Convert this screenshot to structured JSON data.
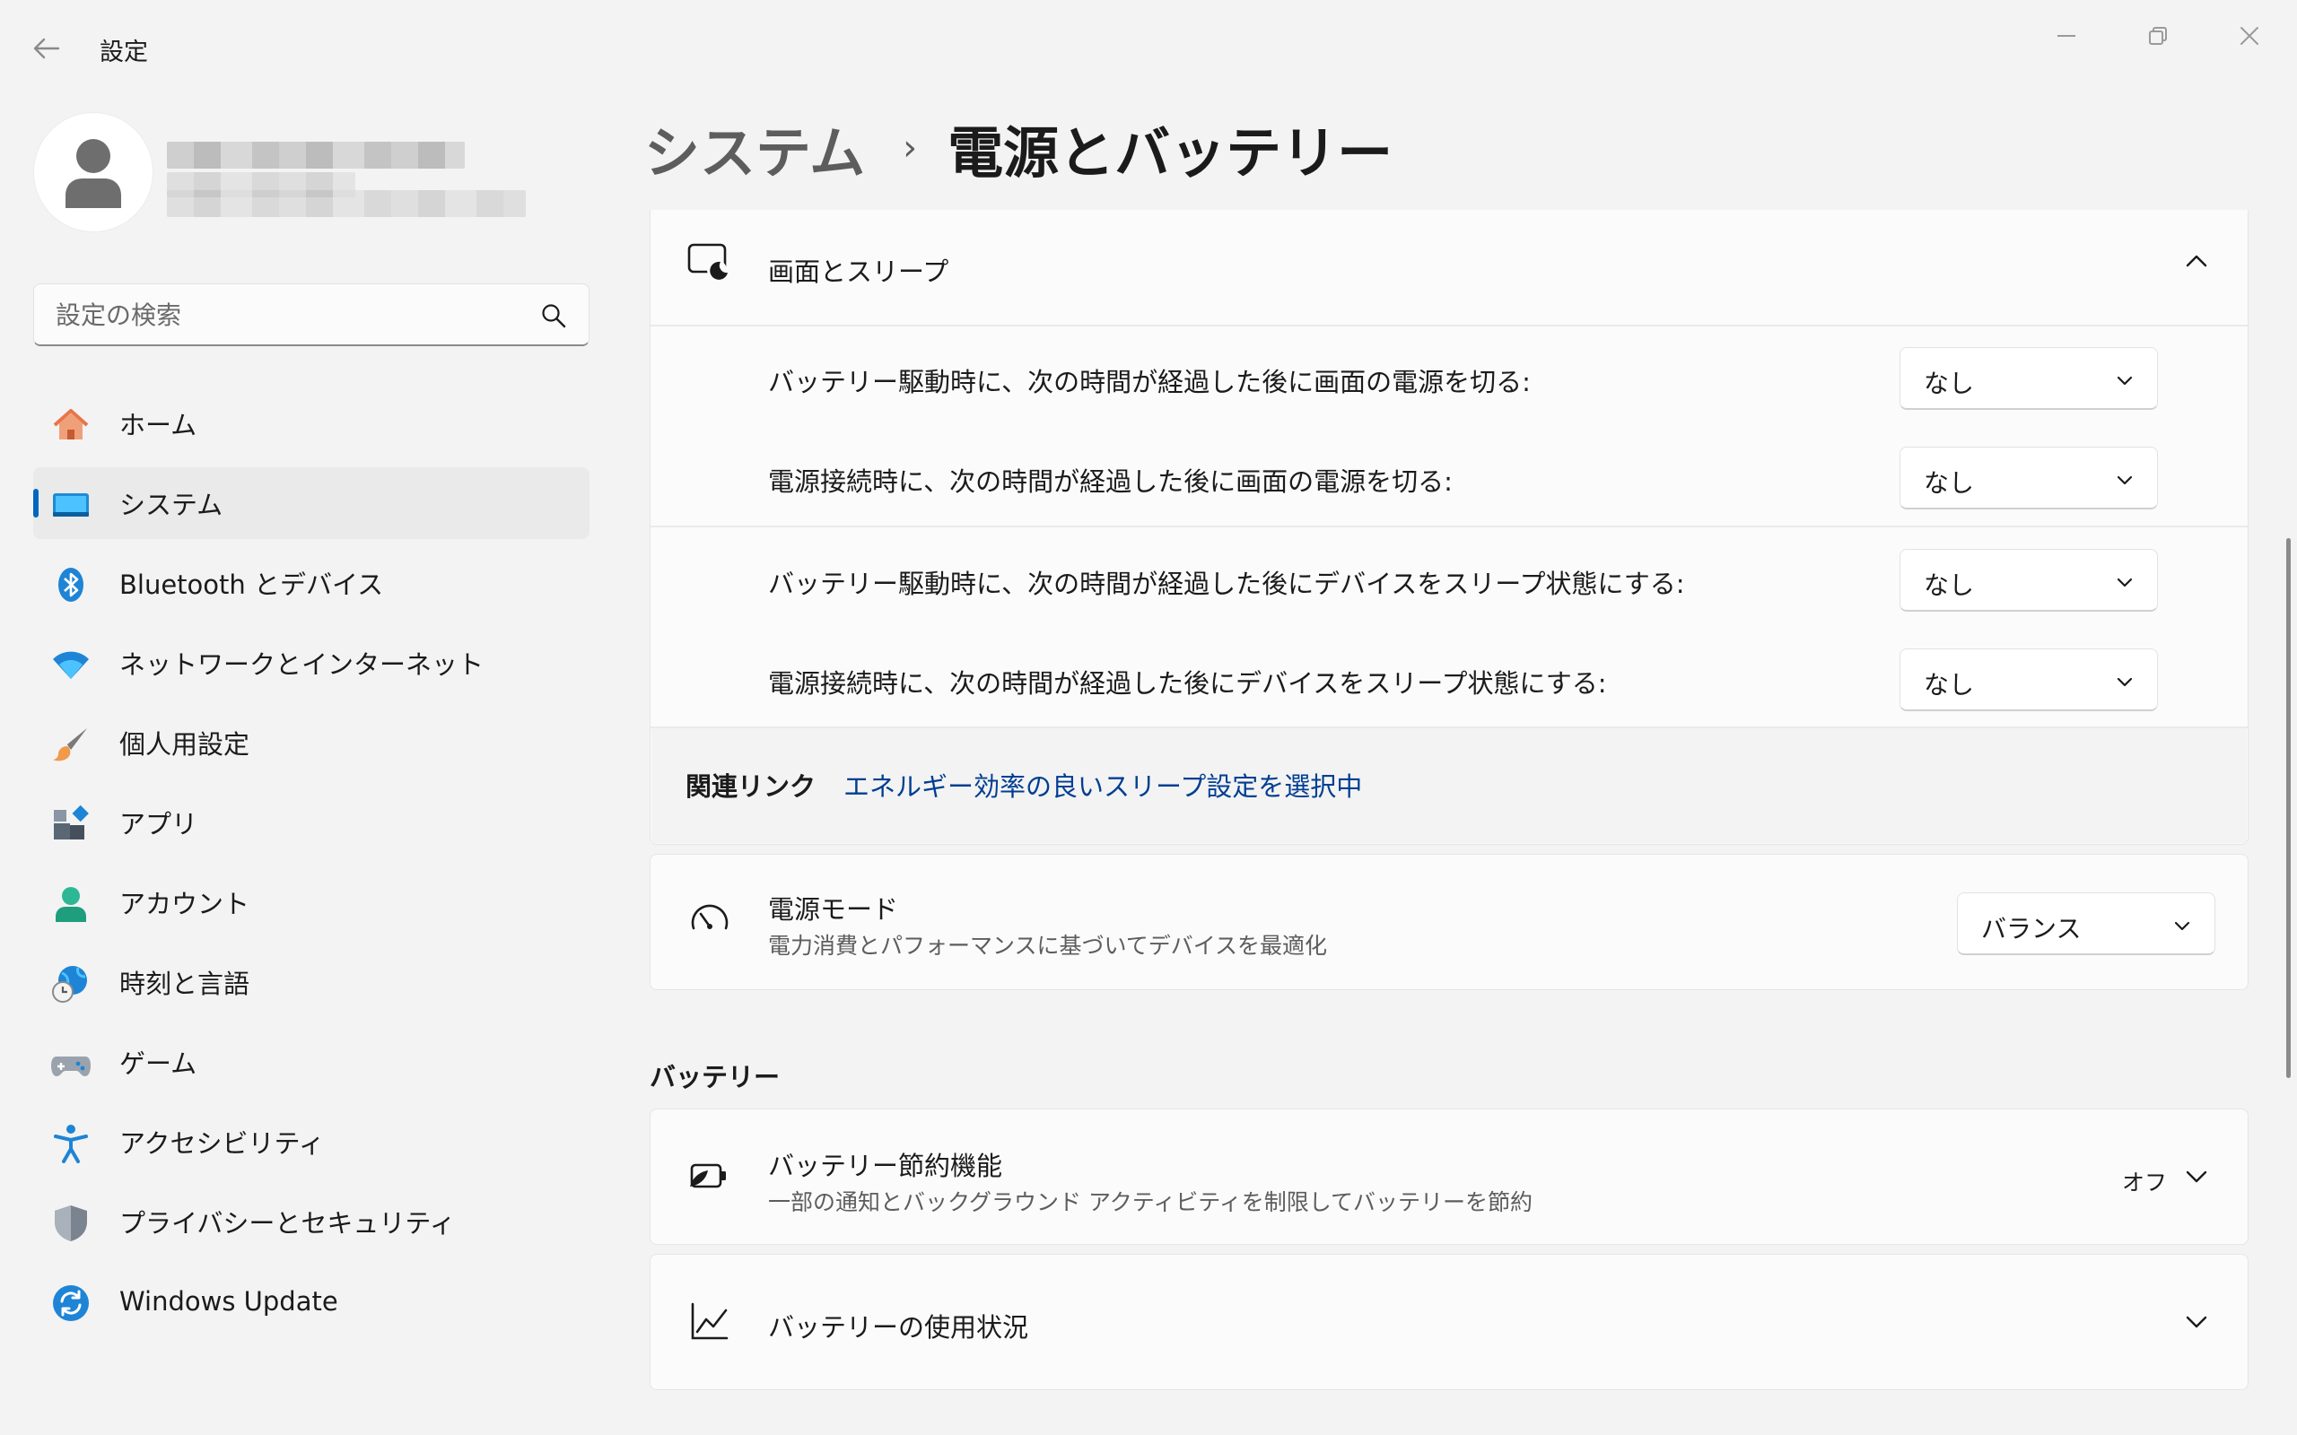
{
  "window": {
    "title": "設定"
  },
  "search": {
    "placeholder": "設定の検索"
  },
  "sidebar": {
    "items": [
      {
        "label": "ホーム",
        "icon": "home-icon"
      },
      {
        "label": "システム",
        "icon": "system-icon",
        "selected": true
      },
      {
        "label": "Bluetooth とデバイス",
        "icon": "bluetooth-icon"
      },
      {
        "label": "ネットワークとインターネット",
        "icon": "wifi-icon"
      },
      {
        "label": "個人用設定",
        "icon": "brush-icon"
      },
      {
        "label": "アプリ",
        "icon": "apps-icon"
      },
      {
        "label": "アカウント",
        "icon": "account-icon"
      },
      {
        "label": "時刻と言語",
        "icon": "globe-clock-icon"
      },
      {
        "label": "ゲーム",
        "icon": "gamepad-icon"
      },
      {
        "label": "アクセシビリティ",
        "icon": "accessibility-icon"
      },
      {
        "label": "プライバシーとセキュリティ",
        "icon": "shield-icon"
      },
      {
        "label": "Windows Update",
        "icon": "update-icon"
      }
    ]
  },
  "breadcrumb": {
    "parent": "システム",
    "separator": "›",
    "current": "電源とバッテリー"
  },
  "screen_sleep": {
    "title": "画面とスリープ",
    "rows": [
      {
        "label": "バッテリー駆動時に、次の時間が経過した後に画面の電源を切る:",
        "value": "なし"
      },
      {
        "label": "電源接続時に、次の時間が経過した後に画面の電源を切る:",
        "value": "なし"
      },
      {
        "label": "バッテリー駆動時に、次の時間が経過した後にデバイスをスリープ状態にする:",
        "value": "なし"
      },
      {
        "label": "電源接続時に、次の時間が経過した後にデバイスをスリープ状態にする:",
        "value": "なし"
      }
    ]
  },
  "related": {
    "title": "関連リンク",
    "link": "エネルギー効率の良いスリープ設定を選択中"
  },
  "power_mode": {
    "title": "電源モード",
    "subtitle": "電力消費とパフォーマンスに基づいてデバイスを最適化",
    "value": "バランス"
  },
  "battery": {
    "section_title": "バッテリー",
    "saver": {
      "title": "バッテリー節約機能",
      "subtitle": "一部の通知とバックグラウンド アクティビティを制限してバッテリーを節約",
      "status": "オフ"
    },
    "usage": {
      "title": "バッテリーの使用状況"
    }
  },
  "colors": {
    "accent": "#0067c0",
    "link": "#003e92"
  }
}
